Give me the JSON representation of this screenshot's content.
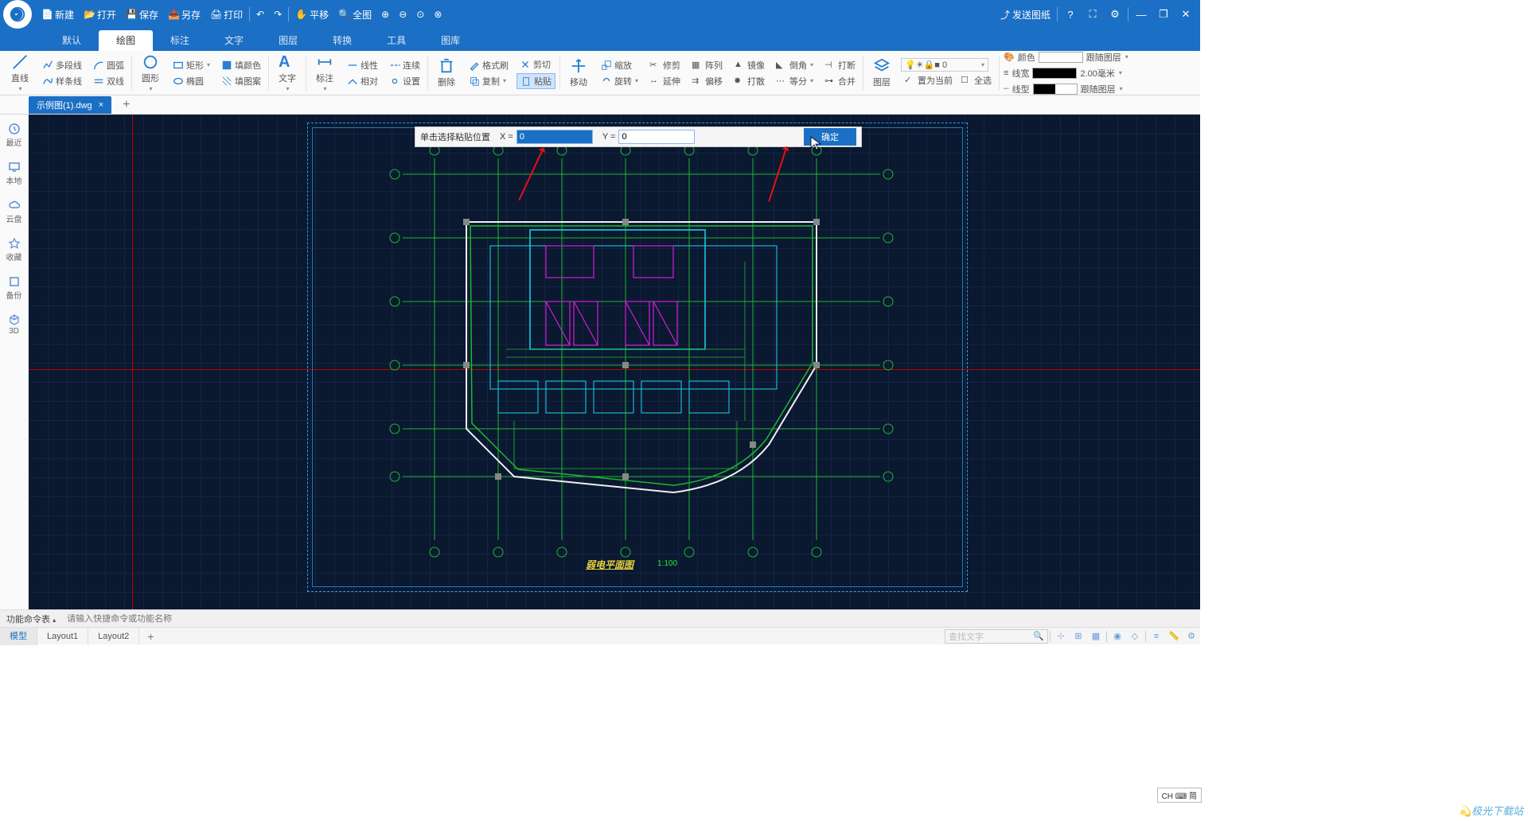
{
  "titlebar": {
    "new": "新建",
    "open": "打开",
    "save": "保存",
    "saveas": "另存",
    "print": "打印",
    "pan": "平移",
    "fitall": "全图",
    "send": "发送图纸"
  },
  "menutabs": [
    "默认",
    "绘图",
    "标注",
    "文字",
    "图层",
    "转换",
    "工具",
    "图库"
  ],
  "menutab_active": 1,
  "ribbon": {
    "line": "直线",
    "polyline": "多段线",
    "arc": "圆弧",
    "spline": "样条线",
    "dblline": "双线",
    "circle": "圆形",
    "rect": "矩形",
    "ellipse": "椭圆",
    "fillcolor": "填颜色",
    "fillpattern": "填图案",
    "text": "文字",
    "annotate": "标注",
    "linear": "线性",
    "continuous": "连续",
    "relative": "相对",
    "settings": "设置",
    "delete": "删除",
    "brush": "格式刷",
    "cut": "剪切",
    "copy": "复制",
    "paste": "粘贴",
    "move": "移动",
    "scale": "缩放",
    "trim": "修剪",
    "array": "阵列",
    "mirror": "镜像",
    "chamfer": "倒角",
    "break": "打断",
    "rotate": "旋转",
    "extend": "延伸",
    "offset": "偏移",
    "scatter": "打散",
    "divide": "等分",
    "merge": "合并",
    "layer": "图层",
    "setcurrent": "置为当前",
    "selectall": "全选",
    "color": "颜色",
    "linewidth": "线宽",
    "linetype": "线型",
    "follow_layer": "跟随图层",
    "lw_val": "2.00毫米",
    "layer_sel": "0"
  },
  "filetab": {
    "name": "示例图(1).dwg"
  },
  "sidebar": [
    "最近",
    "本地",
    "云盘",
    "收藏",
    "备份",
    "3D"
  ],
  "coord": {
    "prompt": "单击选择粘贴位置",
    "xlabel": "X =",
    "xval": "0",
    "ylabel": "Y =",
    "yval": "0",
    "ok": "确定"
  },
  "drawing": {
    "title": "弱电平面图",
    "scale": "1:100"
  },
  "cmdbar": {
    "label": "功能命令表",
    "placeholder": "请输入快捷命令或功能名称"
  },
  "layouts": [
    "模型",
    "Layout1",
    "Layout2"
  ],
  "layout_active": 0,
  "ime": "CH ⌨ 简",
  "search_placeholder": "查找文字",
  "watermark": "极光下载站"
}
